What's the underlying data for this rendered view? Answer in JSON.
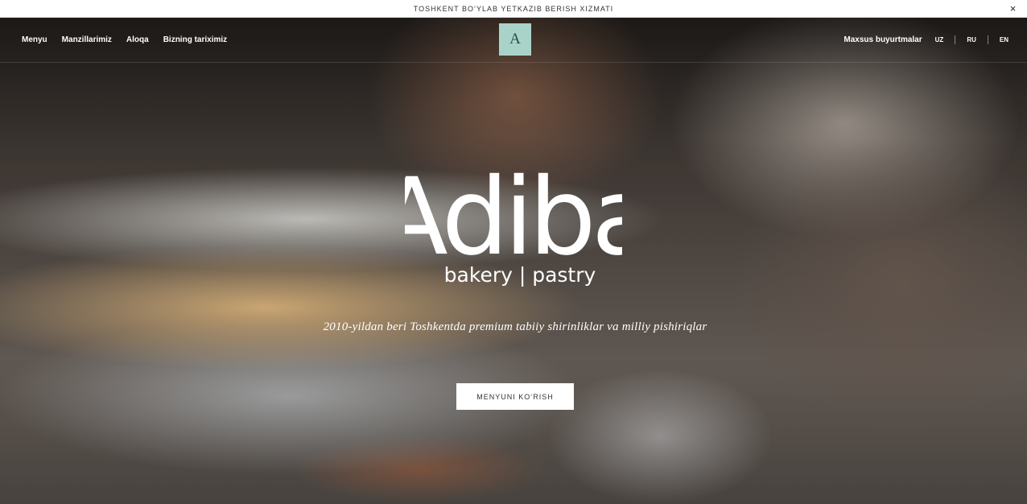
{
  "announcement": {
    "text": "TOSHKENT BO‘YLAB YETKAZIB BERISH XIZMATI",
    "close_symbol": "×"
  },
  "header": {
    "nav_left": [
      "Menyu",
      "Manzillarimiz",
      "Aloqa",
      "Bizning tariximiz"
    ],
    "logo_letter": "A",
    "special_orders": "Maxsus buyurtmalar",
    "languages": [
      "UZ",
      "RU",
      "EN"
    ]
  },
  "hero": {
    "brand_name": "Adiba",
    "brand_subtitle": "bakery | pastry",
    "tagline": "2010-yildan beri Toshkentda premium tabiiy shirinliklar va milliy pishiriqlar",
    "cta_label": "MENYUNI KO‘RISH"
  },
  "colors": {
    "logo_bg": "#a9d3c9",
    "cta_bg": "#ffffff",
    "announcement_bg": "#ffffff"
  }
}
